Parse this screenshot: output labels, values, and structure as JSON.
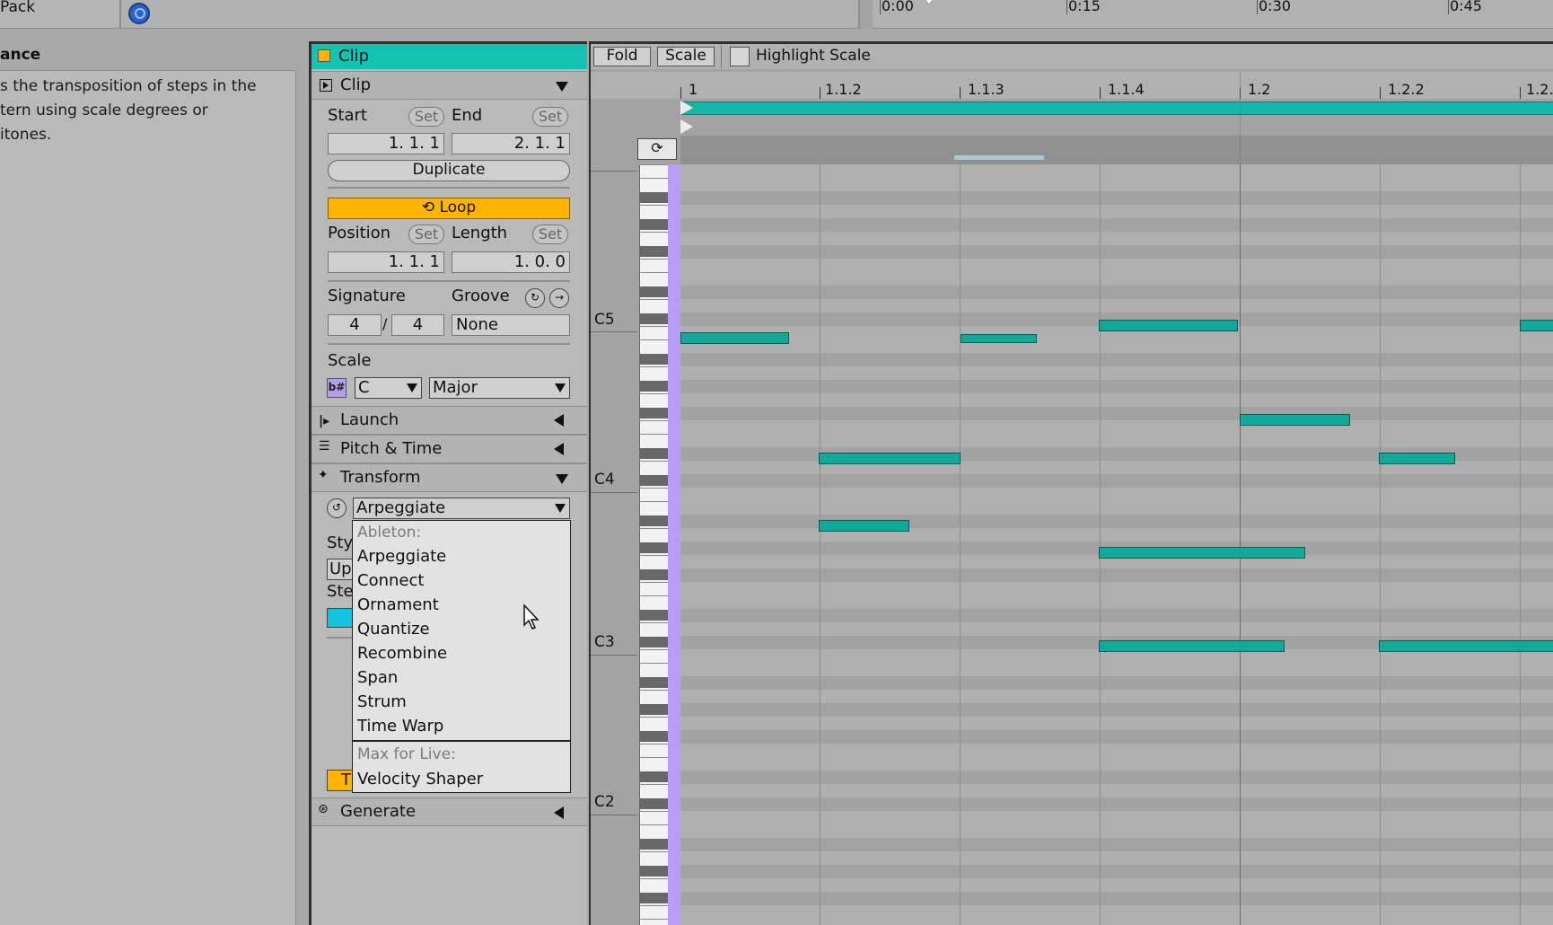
{
  "top": {
    "pack_label": "Pack",
    "time_labels": [
      "0:00",
      "0:15",
      "0:30",
      "0:45"
    ]
  },
  "info": {
    "title": "ance",
    "lines": [
      "s the transposition of steps in the",
      "tern using scale degrees or",
      "itones."
    ]
  },
  "clip": {
    "header": "Clip",
    "section_clip": "Clip",
    "start_label": "Start",
    "end_label": "End",
    "set_label": "Set",
    "start_value": "1.  1.  1",
    "end_value": "2.  1.  1",
    "duplicate_label": "Duplicate",
    "loop_label": "Loop",
    "position_label": "Position",
    "length_label": "Length",
    "position_value": "1.  1.  1",
    "length_value": "1.  0.  0",
    "signature_label": "Signature",
    "groove_label": "Groove",
    "sig_num": "4",
    "sig_den": "4",
    "groove_value": "None",
    "scale_label": "Scale",
    "scale_root": "C",
    "scale_mode": "Major"
  },
  "sections": {
    "launch": "Launch",
    "pitch_time": "Pitch & Time",
    "transform": "Transform",
    "generate": "Generate"
  },
  "transform": {
    "selected": "Arpeggiate",
    "partial_style": "Sty",
    "partial_up": "Up",
    "partial_steps": "Ste",
    "partial_t": "T"
  },
  "menu": {
    "cat_ableton": "Ableton:",
    "items": [
      "Arpeggiate",
      "Connect",
      "Ornament",
      "Quantize",
      "Recombine",
      "Span",
      "Strum",
      "Time Warp"
    ],
    "cat_max": "Max for Live:",
    "max_items": [
      "Velocity Shaper"
    ]
  },
  "editor": {
    "fold_label": "Fold",
    "scale_label": "Scale",
    "highlight_label": "Highlight Scale",
    "beat_labels": [
      "1",
      "1.1.2",
      "1.1.3",
      "1.1.4",
      "1.2",
      "1.2.2",
      "1.2."
    ],
    "octave_labels": [
      "C5",
      "C4",
      "C3",
      "C2"
    ]
  },
  "colors": {
    "accent": "#12c3b2",
    "loop": "#ffb400",
    "note": "#13a99a",
    "scale": "#b69cf2"
  }
}
